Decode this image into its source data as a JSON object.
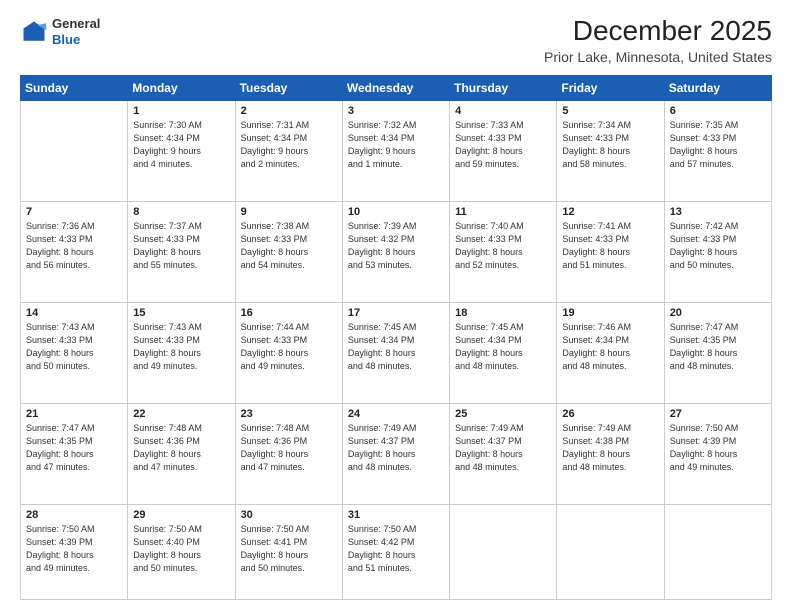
{
  "header": {
    "logo": {
      "line1": "General",
      "line2": "Blue"
    },
    "title": "December 2025",
    "subtitle": "Prior Lake, Minnesota, United States"
  },
  "days_of_week": [
    "Sunday",
    "Monday",
    "Tuesday",
    "Wednesday",
    "Thursday",
    "Friday",
    "Saturday"
  ],
  "weeks": [
    [
      {
        "day": "",
        "info": ""
      },
      {
        "day": "1",
        "info": "Sunrise: 7:30 AM\nSunset: 4:34 PM\nDaylight: 9 hours\nand 4 minutes."
      },
      {
        "day": "2",
        "info": "Sunrise: 7:31 AM\nSunset: 4:34 PM\nDaylight: 9 hours\nand 2 minutes."
      },
      {
        "day": "3",
        "info": "Sunrise: 7:32 AM\nSunset: 4:34 PM\nDaylight: 9 hours\nand 1 minute."
      },
      {
        "day": "4",
        "info": "Sunrise: 7:33 AM\nSunset: 4:33 PM\nDaylight: 8 hours\nand 59 minutes."
      },
      {
        "day": "5",
        "info": "Sunrise: 7:34 AM\nSunset: 4:33 PM\nDaylight: 8 hours\nand 58 minutes."
      },
      {
        "day": "6",
        "info": "Sunrise: 7:35 AM\nSunset: 4:33 PM\nDaylight: 8 hours\nand 57 minutes."
      }
    ],
    [
      {
        "day": "7",
        "info": "Sunrise: 7:36 AM\nSunset: 4:33 PM\nDaylight: 8 hours\nand 56 minutes."
      },
      {
        "day": "8",
        "info": "Sunrise: 7:37 AM\nSunset: 4:33 PM\nDaylight: 8 hours\nand 55 minutes."
      },
      {
        "day": "9",
        "info": "Sunrise: 7:38 AM\nSunset: 4:33 PM\nDaylight: 8 hours\nand 54 minutes."
      },
      {
        "day": "10",
        "info": "Sunrise: 7:39 AM\nSunset: 4:32 PM\nDaylight: 8 hours\nand 53 minutes."
      },
      {
        "day": "11",
        "info": "Sunrise: 7:40 AM\nSunset: 4:33 PM\nDaylight: 8 hours\nand 52 minutes."
      },
      {
        "day": "12",
        "info": "Sunrise: 7:41 AM\nSunset: 4:33 PM\nDaylight: 8 hours\nand 51 minutes."
      },
      {
        "day": "13",
        "info": "Sunrise: 7:42 AM\nSunset: 4:33 PM\nDaylight: 8 hours\nand 50 minutes."
      }
    ],
    [
      {
        "day": "14",
        "info": "Sunrise: 7:43 AM\nSunset: 4:33 PM\nDaylight: 8 hours\nand 50 minutes."
      },
      {
        "day": "15",
        "info": "Sunrise: 7:43 AM\nSunset: 4:33 PM\nDaylight: 8 hours\nand 49 minutes."
      },
      {
        "day": "16",
        "info": "Sunrise: 7:44 AM\nSunset: 4:33 PM\nDaylight: 8 hours\nand 49 minutes."
      },
      {
        "day": "17",
        "info": "Sunrise: 7:45 AM\nSunset: 4:34 PM\nDaylight: 8 hours\nand 48 minutes."
      },
      {
        "day": "18",
        "info": "Sunrise: 7:45 AM\nSunset: 4:34 PM\nDaylight: 8 hours\nand 48 minutes."
      },
      {
        "day": "19",
        "info": "Sunrise: 7:46 AM\nSunset: 4:34 PM\nDaylight: 8 hours\nand 48 minutes."
      },
      {
        "day": "20",
        "info": "Sunrise: 7:47 AM\nSunset: 4:35 PM\nDaylight: 8 hours\nand 48 minutes."
      }
    ],
    [
      {
        "day": "21",
        "info": "Sunrise: 7:47 AM\nSunset: 4:35 PM\nDaylight: 8 hours\nand 47 minutes."
      },
      {
        "day": "22",
        "info": "Sunrise: 7:48 AM\nSunset: 4:36 PM\nDaylight: 8 hours\nand 47 minutes."
      },
      {
        "day": "23",
        "info": "Sunrise: 7:48 AM\nSunset: 4:36 PM\nDaylight: 8 hours\nand 47 minutes."
      },
      {
        "day": "24",
        "info": "Sunrise: 7:49 AM\nSunset: 4:37 PM\nDaylight: 8 hours\nand 48 minutes."
      },
      {
        "day": "25",
        "info": "Sunrise: 7:49 AM\nSunset: 4:37 PM\nDaylight: 8 hours\nand 48 minutes."
      },
      {
        "day": "26",
        "info": "Sunrise: 7:49 AM\nSunset: 4:38 PM\nDaylight: 8 hours\nand 48 minutes."
      },
      {
        "day": "27",
        "info": "Sunrise: 7:50 AM\nSunset: 4:39 PM\nDaylight: 8 hours\nand 49 minutes."
      }
    ],
    [
      {
        "day": "28",
        "info": "Sunrise: 7:50 AM\nSunset: 4:39 PM\nDaylight: 8 hours\nand 49 minutes."
      },
      {
        "day": "29",
        "info": "Sunrise: 7:50 AM\nSunset: 4:40 PM\nDaylight: 8 hours\nand 50 minutes."
      },
      {
        "day": "30",
        "info": "Sunrise: 7:50 AM\nSunset: 4:41 PM\nDaylight: 8 hours\nand 50 minutes."
      },
      {
        "day": "31",
        "info": "Sunrise: 7:50 AM\nSunset: 4:42 PM\nDaylight: 8 hours\nand 51 minutes."
      },
      {
        "day": "",
        "info": ""
      },
      {
        "day": "",
        "info": ""
      },
      {
        "day": "",
        "info": ""
      }
    ]
  ]
}
